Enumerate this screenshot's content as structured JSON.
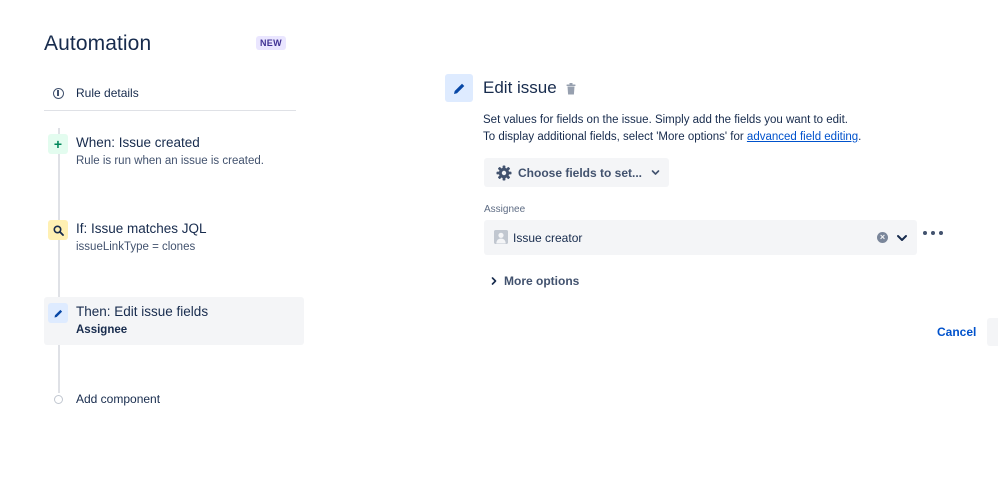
{
  "header": {
    "title": "Automation",
    "badge": "NEW"
  },
  "sidebar": {
    "rule_details_label": "Rule details",
    "steps": [
      {
        "title": "When: Issue created",
        "subtitle": "Rule is run when an issue is created.",
        "icon": "plus-icon"
      },
      {
        "title": "If: Issue matches JQL",
        "subtitle": "issueLinkType = clones",
        "icon": "search-icon"
      },
      {
        "title": "Then: Edit issue fields",
        "subtitle": "Assignee",
        "icon": "pencil-icon",
        "selected": true
      }
    ],
    "add_component_label": "Add component"
  },
  "editor": {
    "title": "Edit issue",
    "description_line1": "Set values for fields on the issue. Simply add the fields you want to edit.",
    "description_line2_prefix": "To display additional fields, select 'More options' for ",
    "description_link": "advanced field editing",
    "description_line2_suffix": ".",
    "choose_fields_label": "Choose fields to set...",
    "field_label": "Assignee",
    "field_value": "Issue creator",
    "more_options_label": "More options",
    "cancel_label": "Cancel"
  },
  "colors": {
    "accent": "#0052cc",
    "text": "#172b4d",
    "subtle_bg": "#f4f5f7",
    "trigger_green": "#00875a",
    "condition_yellow": "#fff0b3",
    "action_blue": "#deebff",
    "badge_bg": "#eae6ff"
  }
}
